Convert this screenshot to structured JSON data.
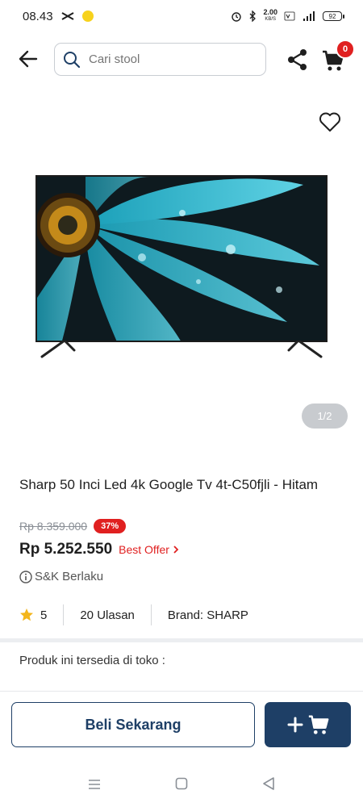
{
  "status_bar": {
    "time": "08.43",
    "net_speed_value": "2.00",
    "net_speed_unit": "KB/S",
    "battery": "92"
  },
  "search": {
    "placeholder": "Cari stool"
  },
  "cart": {
    "badge_count": "0"
  },
  "gallery": {
    "counter": "1/2"
  },
  "product": {
    "title": "Sharp 50 Inci Led 4k Google Tv 4t-C50fjli - Hitam",
    "old_price": "Rp 8.359.000",
    "discount": "37%",
    "price": "Rp 5.252.550",
    "best_offer_label": "Best Offer",
    "terms_label": "S&K Berlaku",
    "rating": "5",
    "reviews": "20 Ulasan",
    "brand": "Brand: SHARP",
    "store_note": "Produk ini tersedia di toko :"
  },
  "actions": {
    "buy_now_label": "Beli Sekarang",
    "add_to_cart_symbol": "+"
  },
  "colors": {
    "brand_navy": "#1e3f66",
    "sale_red": "#e02020",
    "star_gold": "#f3b51b"
  }
}
